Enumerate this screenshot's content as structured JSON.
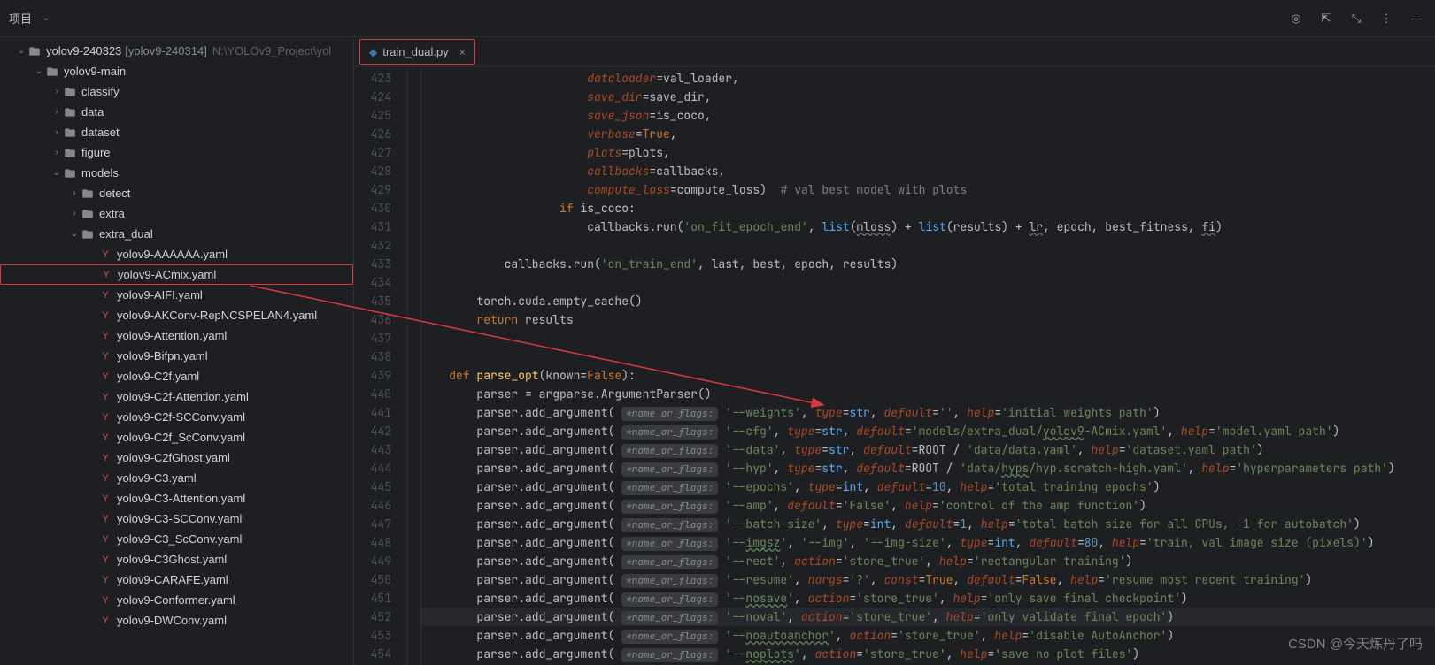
{
  "toolbar": {
    "project_label": "项目"
  },
  "project": {
    "root_name": "yolov9-240323",
    "root_branch": "[yolov9-240314]",
    "root_path": "N:\\YOLOv9_Project\\yol",
    "main_folder": "yolov9-main",
    "folders": [
      "classify",
      "data",
      "dataset",
      "figure"
    ],
    "models": "models",
    "models_sub": [
      "detect",
      "extra"
    ],
    "extra_dual": "extra_dual",
    "files": [
      "yolov9-AAAAAA.yaml",
      "yolov9-ACmix.yaml",
      "yolov9-AIFI.yaml",
      "yolov9-AKConv-RepNCSPELAN4.yaml",
      "yolov9-Attention.yaml",
      "yolov9-Bifpn.yaml",
      "yolov9-C2f.yaml",
      "yolov9-C2f-Attention.yaml",
      "yolov9-C2f-SCConv.yaml",
      "yolov9-C2f_ScConv.yaml",
      "yolov9-C2fGhost.yaml",
      "yolov9-C3.yaml",
      "yolov9-C3-Attention.yaml",
      "yolov9-C3-SCConv.yaml",
      "yolov9-C3_ScConv.yaml",
      "yolov9-C3Ghost.yaml",
      "yolov9-CARAFE.yaml",
      "yolov9-Conformer.yaml",
      "yolov9-DWConv.yaml"
    ]
  },
  "tab": {
    "name": "train_dual.py"
  },
  "gutter": {
    "start": 423,
    "end": 454
  },
  "watermark": "CSDN @今天炼丹了吗",
  "chart_data": null,
  "code": {
    "hint": "*name_or_flags:",
    "l423": {
      "dataloader": "dataloader",
      "val_loader": "val_loader"
    },
    "l424": {
      "save_dir": "save_dir",
      "rhs": "save_dir"
    },
    "l425": {
      "save_json": "save_json",
      "rhs": "is_coco"
    },
    "l426": {
      "verbose": "verbose",
      "true": "True"
    },
    "l427": {
      "plots": "plots",
      "rhs": "plots"
    },
    "l428": {
      "callbacks": "callbacks",
      "rhs": "callbacks"
    },
    "l429": {
      "compute_loss": "compute_loss",
      "rhs": "compute_loss",
      "comment": "# val best model with plots"
    },
    "l430": {
      "if": "if",
      "is_coco": "is_coco"
    },
    "l431": {
      "run": "callbacks.run(",
      "s": "'on_fit_epoch_end'",
      "list": "list",
      "mloss": "mloss",
      "lr": "lr",
      "rest": ", epoch, best_fitness, ",
      "fi": "fi"
    },
    "l433": {
      "run": "callbacks.run(",
      "s": "'on_train_end'",
      "rest": ", last, best, epoch, results)"
    },
    "l435": "torch.cuda.empty_cache()",
    "l436": {
      "return": "return",
      "results": " results"
    },
    "l439": {
      "def": "def ",
      "fn": "parse_opt",
      "known": "known",
      "false": "False"
    },
    "l440": "    parser = argparse.ArgumentParser()",
    "args": [
      {
        "ln": 441,
        "flag": "'--weights'",
        "extra": ", type=str, default='', help='initial weights path')"
      },
      {
        "ln": 442,
        "flag": "'--cfg'",
        "extra": ", type=str, default='models/extra_dual/yolov9-ACmix.yaml', help='model.yaml path')",
        "special": true
      },
      {
        "ln": 443,
        "flag": "'--data'",
        "extra": ", type=str, default=ROOT / 'data/data.yaml', help='dataset.yaml path')"
      },
      {
        "ln": 444,
        "flag": "'--hyp'",
        "extra": ", type=str, default=ROOT / 'data/hyps/hyp.scratch-high.yaml', help='hyperparameters path')"
      },
      {
        "ln": 445,
        "flag": "'--epochs'",
        "extra": ", type=int, default=10, help='total training epochs')"
      },
      {
        "ln": 446,
        "flag": "'--amp'",
        "extra": ", default='False', help='control of the amp function')"
      },
      {
        "ln": 447,
        "flag": "'--batch-size'",
        "extra": ", type=int, default=1, help='total batch size for all GPUs, -1 for autobatch')"
      },
      {
        "ln": 448,
        "flag": "'--imgsz', '--img', '--img-size'",
        "extra": ", type=int, default=80, help='train, val image size (pixels)')"
      },
      {
        "ln": 449,
        "flag": "'--rect'",
        "extra": ", action='store_true', help='rectangular training')"
      },
      {
        "ln": 450,
        "flag": "'--resume'",
        "extra": ", nargs='?', const=True, default=False, help='resume most recent training')"
      },
      {
        "ln": 451,
        "flag": "'--nosave'",
        "extra": ", action='store_true', help='only save final checkpoint')"
      },
      {
        "ln": 452,
        "flag": "'--noval'",
        "extra": ", action='store_true', help='only validate final epoch')",
        "hl": true
      },
      {
        "ln": 453,
        "flag": "'--noautoanchor'",
        "extra": ", action='store_true', help='disable AutoAnchor')"
      },
      {
        "ln": 454,
        "flag": "'--noplots'",
        "extra": ", action='store_true', help='save no plot files')"
      }
    ]
  }
}
